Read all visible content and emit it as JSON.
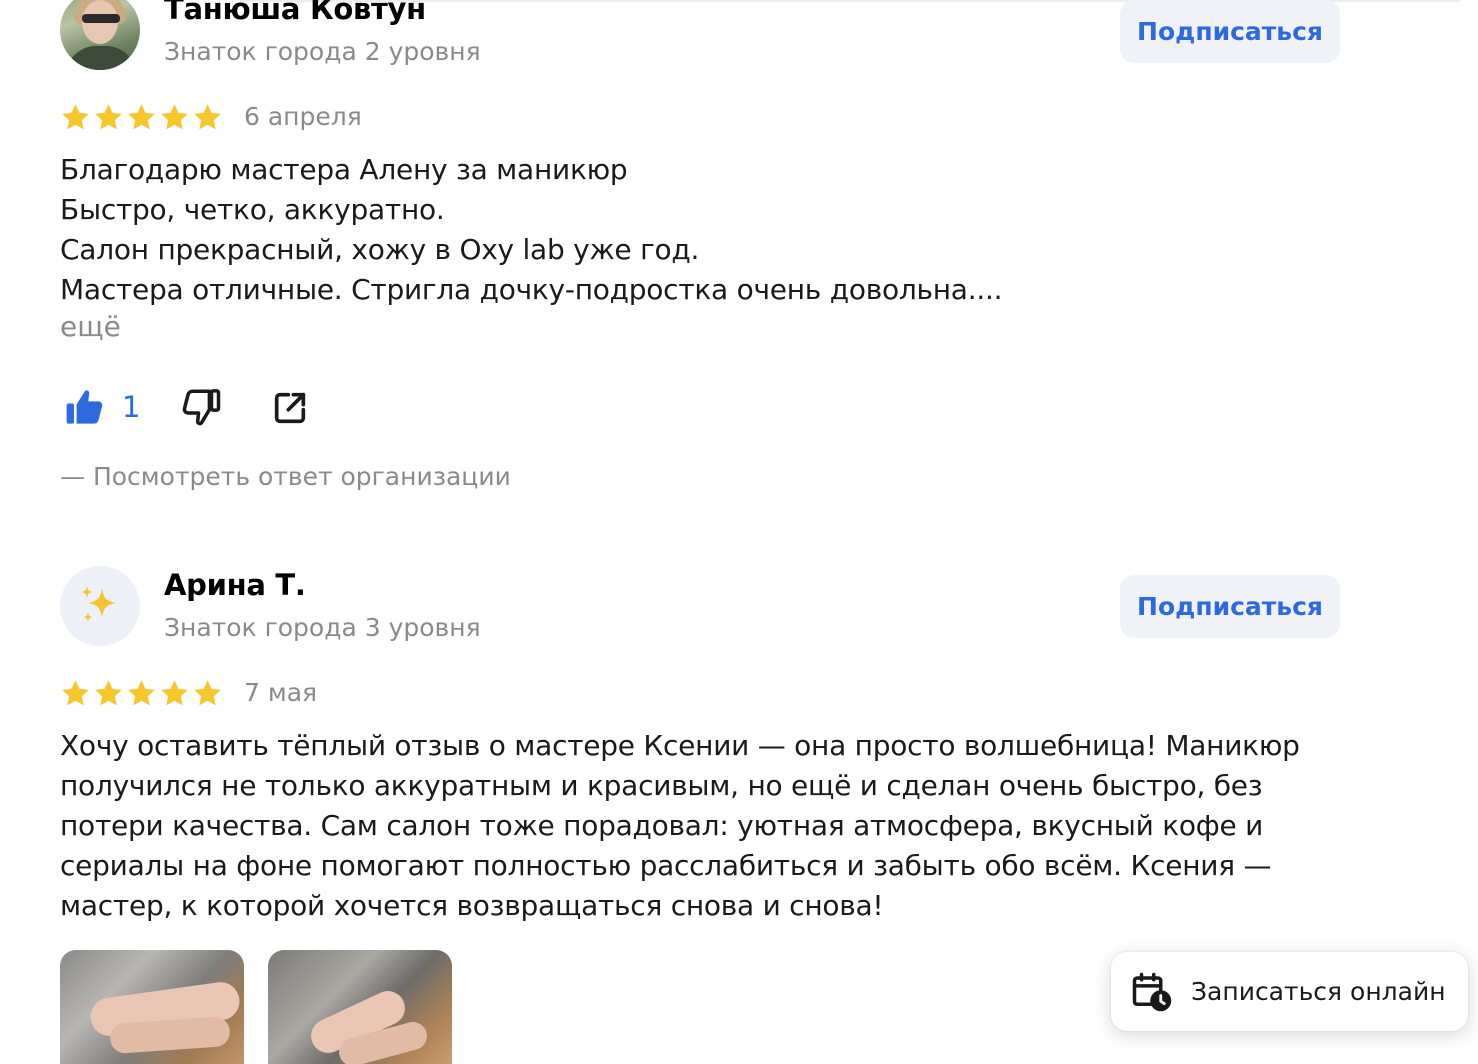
{
  "reviews": [
    {
      "author": "Танюша Ковтун",
      "level": "Знаток города 2 уровня",
      "subscribe_label": "Подписаться",
      "rating": 5,
      "date": "6 апреля",
      "text_lines": [
        "Благодарю мастера Алену за маникюр",
        "Быстро, четко, аккуратно.",
        "Салон прекрасный, хожу в Oxy lab уже год.",
        "Мастера отличные. Стригла дочку-подростка очень довольна...."
      ],
      "more_label": "ещё",
      "likes": "1",
      "org_answer_label": "—  Посмотреть ответ организации",
      "icons": [
        "avatar-photo",
        "thumbs-up-icon",
        "thumbs-down-icon",
        "share-icon"
      ]
    },
    {
      "author": "Арина Т.",
      "level": "Знаток города 3 уровня",
      "subscribe_label": "Подписаться",
      "rating": 5,
      "date": "7 мая",
      "avatar_emoji": "✨",
      "text_lines": [
        "Хочу оставить тёплый отзыв о мастере Ксении — она просто волшебница! Маникюр",
        "получился не только аккуратным и красивым, но ещё и сделан очень быстро, без",
        "потери качества. Сам салон тоже порадовал: уютная атмосфера, вкусный кофе и",
        "сериалы на фоне помогают полностью расслабиться и забыть обо всём. Ксения —",
        "мастер, к которой хочется возвращаться снова и снова!"
      ],
      "photos": [
        "review-photo-1",
        "review-photo-2"
      ]
    }
  ],
  "booking": {
    "label": "Записаться онлайн",
    "icon": "calendar-clock-icon"
  },
  "colors": {
    "accent": "#2d6ae0",
    "star": "#f7c52c",
    "muted": "#8a8a8a",
    "button_bg": "#f0f2f8"
  }
}
